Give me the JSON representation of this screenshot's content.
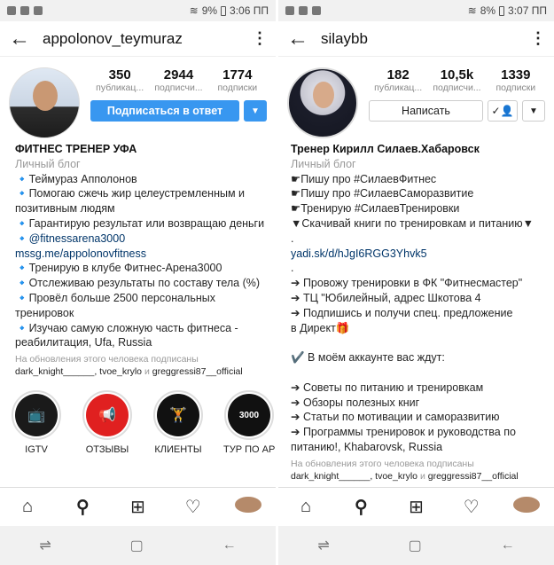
{
  "left": {
    "status": {
      "battery": "9%",
      "time": "3:06 ПП"
    },
    "username": "appolonov_teymuraz",
    "stats": [
      {
        "num": "350",
        "label": "публикац..."
      },
      {
        "num": "2944",
        "label": "подписчи..."
      },
      {
        "num": "1774",
        "label": "подписки"
      }
    ],
    "follow_label": "Подписаться в ответ",
    "bio": {
      "name": "ФИТНЕС ТРЕНЕР УФА",
      "category": "Личный блог",
      "lines": [
        "🔹Теймураз Апполонов",
        "🔹Помогаю сжечь жир целеустремленным и",
        "позитивным людям",
        "🔹Гарантирую результат или возвращаю деньги",
        "🔹@fitnessarena3000",
        "mssg.me/appolonovfitness",
        "🔹Тренирую в клубе Фитнес-Арена3000",
        "🔹Отслеживаю результаты по составу тела (%)",
        "🔹Провёл больше 2500 персональных",
        "тренировок",
        "🔹Изучаю самую сложную часть фитнеса -",
        "реабилитация, Ufa, Russia"
      ]
    },
    "followed_by": "На обновления этого человека подписаны",
    "followed_names": {
      "a": "dark_knight______",
      "b": "tvoe_krylo",
      "and": "и",
      "c": "greggressi87__official"
    },
    "highlights": [
      {
        "label": "IGTV",
        "glyph": "📺"
      },
      {
        "label": "ОТЗЫВЫ",
        "glyph": "📢"
      },
      {
        "label": "КЛИЕНТЫ",
        "glyph": "🏋"
      },
      {
        "label": "ТУР ПО АРЕ...",
        "glyph": "3000"
      },
      {
        "label": "",
        "glyph": ""
      }
    ]
  },
  "right": {
    "status": {
      "battery": "8%",
      "time": "3:07 ПП"
    },
    "username": "silaybb",
    "stats": [
      {
        "num": "182",
        "label": "публикац..."
      },
      {
        "num": "10,5k",
        "label": "подписчи..."
      },
      {
        "num": "1339",
        "label": "подписки"
      }
    ],
    "message_label": "Написать",
    "bio": {
      "name": "Тренер Кирилл Силаев.Хабаровск",
      "category": "Личный блог",
      "lines": [
        "☛Пишу про #СилаевФитнес",
        "☛Пишу про #СилаевСаморазвитие",
        "☛Тренирую #СилаевТренировки",
        "▼Скачивай книги по тренировкам и питанию▼",
        ".",
        "yadi.sk/d/hJgI6RGG3Yhvk5",
        ".",
        "➔ Провожу тренировки в ФК \"Фитнесмастер\"",
        "➔ ТЦ \"Юбилейный, адрес Шкотова 4",
        "➔ Подпишись и получи спец. предложение",
        "в Директ🎁",
        "",
        "✔️ В моём аккаунте вас ждут:",
        "",
        "➔ Советы по питанию и тренировкам",
        "➔ Обзоры полезных книг",
        "➔ Статьи по мотивации и саморазвитию",
        "➔ Программы тренировок и руководства по",
        "питанию!, Khabarovsk, Russia"
      ]
    },
    "followed_by": "На обновления этого человека подписаны",
    "followed_names": {
      "a": "dark_knight______",
      "b": "tvoe_krylo",
      "and": "и",
      "c": "greggressi87__official"
    }
  },
  "icons": {
    "back": "←",
    "menu": "⋮",
    "chevron": "▼",
    "home": "⌂",
    "search": "⚲",
    "add": "⊞",
    "heart": "♡",
    "recent": "⇌",
    "overview": "▢",
    "sysback": "←"
  },
  "colors": {
    "accent": "#3897f0",
    "link": "#003569"
  }
}
